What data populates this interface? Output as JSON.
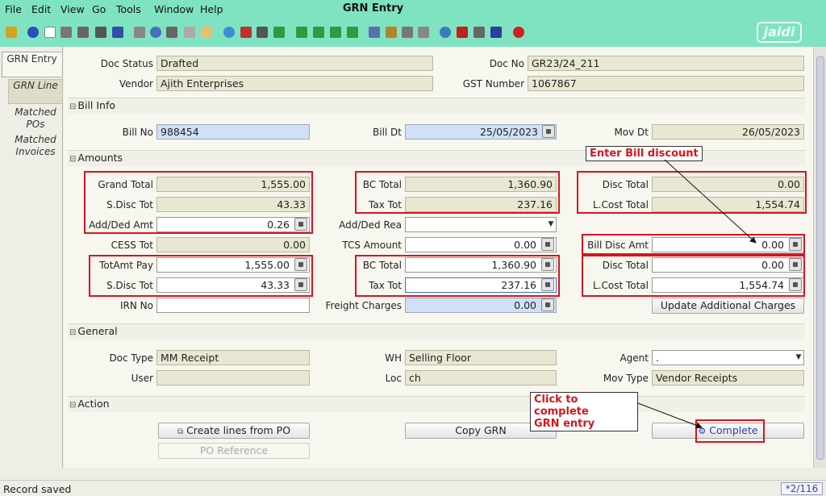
{
  "menu": [
    "File",
    "Edit",
    "View",
    "Go",
    "Tools",
    "Window",
    "Help"
  ],
  "window_title": "GRN Entry",
  "logo_text": "jaldi",
  "left_tabs": [
    "GRN Entry",
    "GRN Line",
    "Matched POs",
    "Matched Invoices"
  ],
  "header": {
    "doc_status_label": "Doc Status",
    "doc_status": "Drafted",
    "doc_no_label": "Doc No",
    "doc_no": "GR23/24_211",
    "vendor_label": "Vendor",
    "vendor": "Ajith Enterprises",
    "gst_label": "GST Number",
    "gst": "1067867"
  },
  "bill_info": {
    "title": "Bill Info",
    "bill_no_label": "Bill No",
    "bill_no": "988454",
    "bill_dt_label": "Bill Dt",
    "bill_dt": "25/05/2023",
    "mov_dt_label": "Mov Dt",
    "mov_dt": "26/05/2023"
  },
  "amounts": {
    "title": "Amounts",
    "grand_total_label": "Grand Total",
    "grand_total": "1,555.00",
    "sdisc_tot_label": "S.Disc Tot",
    "sdisc_tot": "43.33",
    "add_ded_amt_label": "Add/Ded Amt",
    "add_ded_amt": "0.26",
    "cess_tot_label": "CESS Tot",
    "cess_tot": "0.00",
    "totamt_pay_label": "TotAmt Pay",
    "totamt_pay": "1,555.00",
    "sdisc_tot2_label": "S.Disc Tot",
    "sdisc_tot2": "43.33",
    "irn_no_label": "IRN No",
    "irn_no": "",
    "bc_total_label": "BC Total",
    "bc_total": "1,360.90",
    "tax_tot_label": "Tax Tot",
    "tax_tot": "237.16",
    "add_ded_rea_label": "Add/Ded Rea",
    "add_ded_rea": "",
    "tcs_amount_label": "TCS Amount",
    "tcs_amount": "0.00",
    "bc_total2_label": "BC Total",
    "bc_total2": "1,360.90",
    "tax_tot2_label": "Tax Tot",
    "tax_tot2": "237.16",
    "freight_label": "Freight Charges",
    "freight": "0.00",
    "disc_total_label": "Disc Total",
    "disc_total": "0.00",
    "lcost_total_label": "L.Cost Total",
    "lcost_total": "1,554.74",
    "bill_disc_amt_label": "Bill Disc Amt",
    "bill_disc_amt": "0.00",
    "disc_total2_label": "Disc Total",
    "disc_total2": "0.00",
    "lcost_total2_label": "L.Cost Total",
    "lcost_total2": "1,554.74",
    "update_charges_label": "Update Additional Charges"
  },
  "general": {
    "title": "General",
    "doc_type_label": "Doc Type",
    "doc_type": "MM Receipt",
    "user_label": "User",
    "user": "",
    "wh_label": "WH",
    "wh": "Selling Floor",
    "loc_label": "Loc",
    "loc": "ch",
    "agent_label": "Agent",
    "agent": ".",
    "mov_type_label": "Mov Type",
    "mov_type": "Vendor Receipts"
  },
  "action": {
    "title": "Action",
    "create_lines_label": "Create lines from PO",
    "po_reference_label": "PO Reference",
    "copy_grn_label": "Copy GRN",
    "complete_label": "Complete"
  },
  "annotations": {
    "bill_discount": "Enter Bill discount",
    "complete_line1": "Click to complete",
    "complete_line2": "GRN entry"
  },
  "status": {
    "message": "Record saved",
    "page": "*2/116"
  },
  "colors": {
    "annotation_red": "#d9141e",
    "toolbar_green": "#7fe3c2",
    "editable_blue": "#cfe0f7"
  }
}
